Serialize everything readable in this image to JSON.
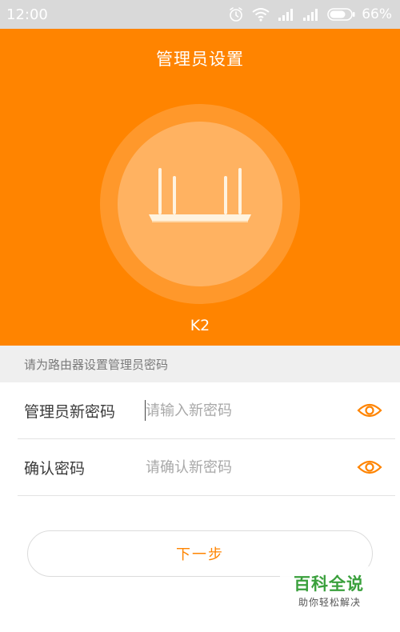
{
  "status_bar": {
    "time": "12:00",
    "battery": "66%",
    "icons": [
      "alarm-icon",
      "wifi-icon",
      "signal-icon",
      "signal-icon",
      "battery-icon"
    ]
  },
  "header": {
    "title": "管理员设置",
    "device_name": "K2",
    "device_icon": "router-icon"
  },
  "hint": "请为路由器设置管理员密码",
  "form": {
    "new_password": {
      "label": "管理员新密码",
      "placeholder": "请输入新密码",
      "value": ""
    },
    "confirm_password": {
      "label": "确认密码",
      "placeholder": "请确认新密码",
      "value": ""
    },
    "toggle_icon": "eye-icon"
  },
  "next_button": "下一步",
  "watermark": {
    "main": "百科全说",
    "sub": "助你轻松解决"
  },
  "colors": {
    "accent": "#ff8400",
    "status_bar": "#d9d9d9",
    "hint_bg": "#efefef",
    "watermark_green": "#3aa03c"
  }
}
